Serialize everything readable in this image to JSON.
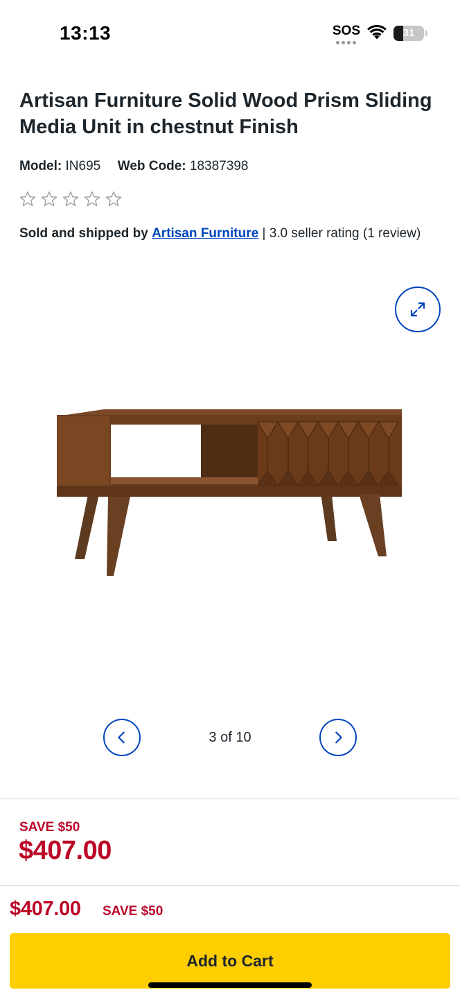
{
  "status_bar": {
    "time": "13:13",
    "sos_label": "SOS",
    "battery_level": "31",
    "battery_percent": 31
  },
  "product": {
    "title": "Artisan Furniture Solid Wood Prism Sliding Media Unit in chestnut Finish",
    "model_label": "Model:",
    "model_value": "IN695",
    "webcode_label": "Web Code:",
    "webcode_value": "18387398",
    "rating_stars_filled": 0,
    "rating_stars_total": 5
  },
  "seller": {
    "prefix": "Sold and shipped by",
    "name": "Artisan Furniture",
    "suffix": "| 3.0 seller rating (1 review)"
  },
  "gallery": {
    "counter": "3 of 10",
    "expand_icon": "expand-arrows-icon",
    "prev_icon": "chevron-left-icon",
    "next_icon": "chevron-right-icon"
  },
  "pricing": {
    "save_label": "SAVE $50",
    "price": "$407.00"
  },
  "sticky": {
    "price": "$407.00",
    "save_label": "SAVE $50",
    "add_to_cart_label": "Add to Cart"
  },
  "colors": {
    "accent_blue": "#0046be",
    "sale_red": "#bb0628",
    "cart_yellow": "#ffce00",
    "wood_brown": "#6b3d1f"
  }
}
